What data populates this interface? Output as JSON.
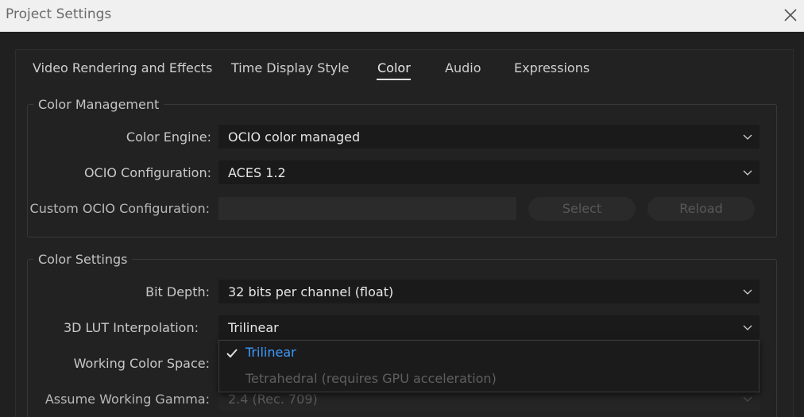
{
  "window": {
    "title": "Project Settings",
    "close_icon": "close-icon"
  },
  "tabs": [
    {
      "label": "Video Rendering and Effects",
      "active": false
    },
    {
      "label": "Time Display Style",
      "active": false
    },
    {
      "label": "Color",
      "active": true
    },
    {
      "label": "Audio",
      "active": false
    },
    {
      "label": "Expressions",
      "active": false
    }
  ],
  "color_management": {
    "title": "Color Management",
    "color_engine": {
      "label": "Color Engine:",
      "value": "OCIO color managed"
    },
    "ocio_configuration": {
      "label": "OCIO Configuration:",
      "value": "ACES 1.2"
    },
    "custom_ocio": {
      "label": "Custom OCIO Configuration:",
      "value": "",
      "enabled": false
    },
    "select_button": {
      "label": "Select",
      "enabled": false
    },
    "reload_button": {
      "label": "Reload",
      "enabled": false
    }
  },
  "color_settings": {
    "title": "Color Settings",
    "bit_depth": {
      "label": "Bit Depth:",
      "value": "32 bits per channel (float)"
    },
    "lut_interpolation": {
      "label": "3D LUT Interpolation:",
      "value": "Trilinear"
    },
    "working_color_space": {
      "label": "Working Color Space:"
    },
    "assume_working_gamma": {
      "label": "Assume Working Gamma:",
      "value": "2.4 (Rec. 709)",
      "enabled": false
    }
  },
  "lut_dropdown": {
    "open": true,
    "options": [
      {
        "label": "Trilinear",
        "selected": true,
        "enabled": true
      },
      {
        "label": "Tetrahedral (requires GPU acceleration)",
        "selected": false,
        "enabled": false
      }
    ]
  },
  "colors": {
    "accent": "#3f9aff",
    "background": "#202020",
    "titlebar": "#f0f0f0"
  }
}
